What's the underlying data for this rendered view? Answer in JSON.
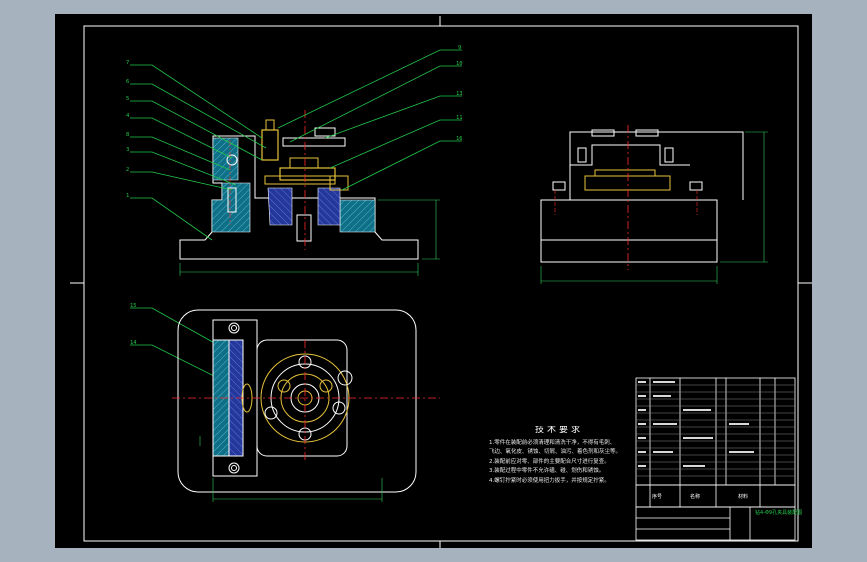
{
  "drawing": {
    "tech_notes": {
      "title": "技术要求",
      "lines": [
        "1.零件在装配前必须清理和清洗干净，不得有毛刺、",
        "飞边、氧化皮、锈蚀、切屑、油污、着色剂和灰尘等。",
        "2.装配前应对零、部件的主要配合尺寸进行复查。",
        "3.装配过程中零件不允许磕、碰、划伤和锈蚀。",
        "4.螺钉拧紧时必须使用扭力扳手，并按规定拧紧。"
      ]
    },
    "title_block": {
      "name": "钻4-Φ9孔夹具装配图",
      "col_seq": "序号",
      "col_name": "名称",
      "col_material": "材料"
    },
    "callouts": [
      "7",
      "6",
      "5",
      "4",
      "8",
      "3",
      "2",
      "1",
      "9",
      "10",
      "13",
      "11",
      "16",
      "15",
      "14"
    ]
  },
  "colors": {
    "outer_bg": "#a7b2bf",
    "sheet": "#000000",
    "line": "#ffffff",
    "leader": "#22c84a",
    "center": "#ff2a2a",
    "part": "#e6c23a",
    "fill_cyan": "#0f6f86",
    "fill_blue": "#2a3f9a",
    "dim": "#2fd05a"
  }
}
